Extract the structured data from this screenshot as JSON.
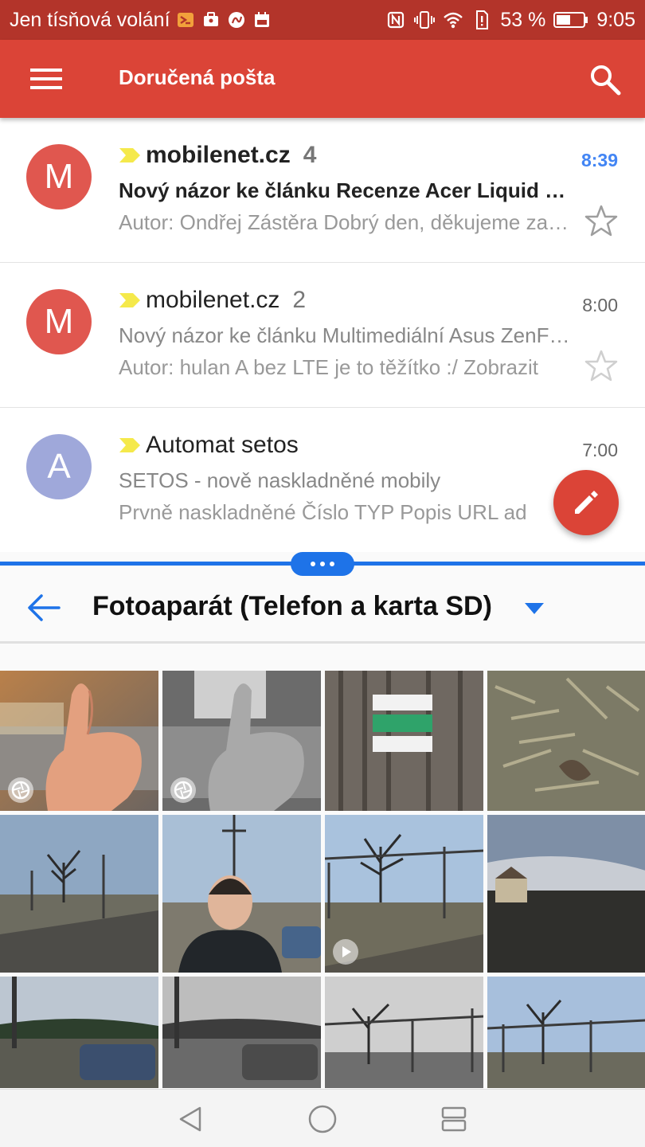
{
  "status_bar": {
    "carrier": "Jen tísňová volání",
    "battery_percent": "53 %",
    "battery_level": 0.53,
    "time": "9:05",
    "icons": [
      "notification-icon",
      "briefcase-icon",
      "gesture-icon",
      "calendar-icon",
      "nfc-icon",
      "vibrate-icon",
      "wifi-icon",
      "battery-saver-icon",
      "battery-icon"
    ]
  },
  "app_bar": {
    "title": "Doručená pošta",
    "menu_icon": "hamburger-menu-icon",
    "search_icon": "search-icon",
    "color": "#db4437"
  },
  "emails": [
    {
      "avatar_letter": "M",
      "avatar_color": "#e0574f",
      "sender": "mobilenet.cz",
      "count": "4",
      "time": "8:39",
      "subject": "Nový názor ke článku Recenze Acer Liquid Zest Plus",
      "snippet": "Autor: Ondřej Zástěra Dobrý den, děkujeme za reakci",
      "unread": true,
      "starred": false
    },
    {
      "avatar_letter": "M",
      "avatar_color": "#e0574f",
      "sender": "mobilenet.cz",
      "count": "2",
      "time": "8:00",
      "subject": "Nový názor ke článku Multimediální Asus ZenFone",
      "snippet": "Autor: hulan A bez LTE je to těžítko :/ Zobrazit",
      "unread": false,
      "starred": false
    },
    {
      "avatar_letter": "A",
      "avatar_color": "#9fa8da",
      "sender": "Automat setos",
      "count": "",
      "time": "7:00",
      "subject": "SETOS - nově naskladněné mobily",
      "snippet": "Prvně naskladněné Číslo TYP Popis URL ad",
      "unread": false,
      "starred": false
    }
  ],
  "fab": {
    "icon": "pencil-compose-icon"
  },
  "gallery": {
    "title": "Fotoaparát (Telefon a karta SD)",
    "back_icon": "arrow-back-icon",
    "dropdown_icon": "dropdown-caret-icon",
    "accent": "#1e73e8",
    "photos": [
      {
        "subject": "thumbs-up-color",
        "badge": "aperture-icon"
      },
      {
        "subject": "thumbs-up-mono",
        "badge": "aperture-icon"
      },
      {
        "subject": "tree-trail-marker",
        "badge": ""
      },
      {
        "subject": "dry-grass",
        "badge": ""
      },
      {
        "subject": "tree-road",
        "badge": ""
      },
      {
        "subject": "selfie-man",
        "badge": ""
      },
      {
        "subject": "tree-power-pole",
        "badge": "play-icon"
      },
      {
        "subject": "house-sunset",
        "badge": ""
      },
      {
        "subject": "car-field",
        "badge": ""
      },
      {
        "subject": "car-field-mono",
        "badge": ""
      },
      {
        "subject": "tree-poles-mono",
        "badge": ""
      },
      {
        "subject": "tree-poles-sky",
        "badge": ""
      }
    ]
  },
  "nav_bar": {
    "back_icon": "nav-back-icon",
    "home_icon": "nav-home-icon",
    "recents_icon": "nav-recents-icon"
  }
}
